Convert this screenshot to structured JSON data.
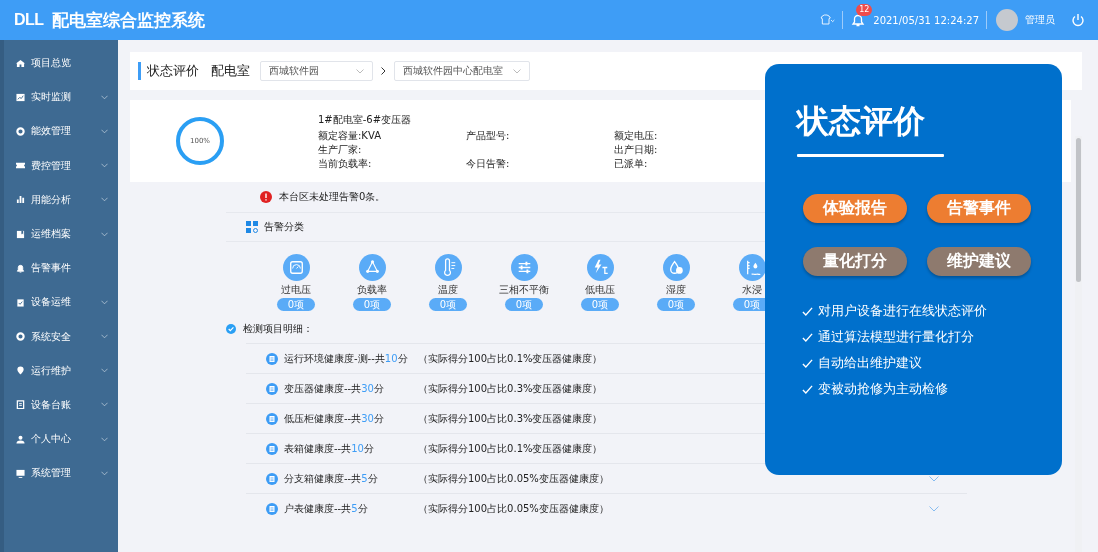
{
  "header": {
    "logo": "DLL",
    "title": "配电室综合监控系统",
    "notification_count": "12",
    "datetime": "2021/05/31 12:24:27",
    "user": "管理员"
  },
  "sidebar": {
    "items": [
      {
        "label": "项目总览",
        "kind": "home",
        "expandable": false
      },
      {
        "label": "实时监测",
        "kind": "chart",
        "expandable": true
      },
      {
        "label": "能效管理",
        "kind": "ring",
        "expandable": true
      },
      {
        "label": "费控管理",
        "kind": "ticket",
        "expandable": true
      },
      {
        "label": "用能分析",
        "kind": "bars",
        "expandable": true
      },
      {
        "label": "运维档案",
        "kind": "book",
        "expandable": true
      },
      {
        "label": "告警事件",
        "kind": "bell",
        "expandable": false
      },
      {
        "label": "设备运维",
        "kind": "clipboard",
        "expandable": true
      },
      {
        "label": "系统安全",
        "kind": "ring",
        "expandable": true
      },
      {
        "label": "运行维护",
        "kind": "pin",
        "expandable": true
      },
      {
        "label": "设备台账",
        "kind": "doc",
        "expandable": true
      },
      {
        "label": "个人中心",
        "kind": "person",
        "expandable": true
      },
      {
        "label": "系统管理",
        "kind": "monitor",
        "expandable": true
      }
    ]
  },
  "page_header": {
    "title": "状态评价",
    "label": "配电室",
    "selects": [
      {
        "value": "西城软件园"
      },
      {
        "value": "西城软件园中心配电室"
      }
    ]
  },
  "device": {
    "score": "100%",
    "level": 1,
    "name": "1#配电室-6#变压器",
    "rows": [
      [
        "额定容量:KVA",
        "产品型号:",
        "额定电压:"
      ],
      [
        "生产厂家:",
        null,
        "出产日期:"
      ],
      [
        "当前负载率:",
        "今日告警:",
        "已派单:"
      ]
    ]
  },
  "alert_notice": "本台区未处理告警0条。",
  "alert_categories": {
    "title": "告警分类",
    "items": [
      {
        "label": "过电压",
        "count": "0项",
        "kind": "gauge"
      },
      {
        "label": "负载率",
        "count": "0项",
        "kind": "triangle"
      },
      {
        "label": "温度",
        "count": "0项",
        "kind": "thermometer"
      },
      {
        "label": "三相不平衡",
        "count": "0项",
        "kind": "sliders"
      },
      {
        "label": "低电压",
        "count": "0项",
        "kind": "bolt"
      },
      {
        "label": "湿度",
        "count": "0项",
        "kind": "drops"
      },
      {
        "label": "水浸",
        "count": "0项",
        "kind": "water"
      }
    ]
  },
  "details": {
    "title": "检测项目明细：",
    "items": [
      {
        "name": "运行环境健康度-测--共",
        "score": "10",
        "unit": "分",
        "note": "（实际得分100占比0.1%变压器健康度）"
      },
      {
        "name": "变压器健康度--共",
        "score": "30",
        "unit": "分",
        "note": "（实际得分100占比0.3%变压器健康度）"
      },
      {
        "name": "低压柜健康度--共",
        "score": "30",
        "unit": "分",
        "note": "（实际得分100占比0.3%变压器健康度）"
      },
      {
        "name": "表箱健康度--共",
        "score": "10",
        "unit": "分",
        "note": "（实际得分100占比0.1%变压器健康度）"
      },
      {
        "name": "分支箱健康度--共",
        "score": "5",
        "unit": "分",
        "note": "（实际得分100占比0.05%变压器健康度）",
        "expandable": true
      },
      {
        "name": "户表健康度--共",
        "score": "5",
        "unit": "分",
        "note": "（实际得分100占比0.05%变压器健康度）",
        "expandable": true
      }
    ]
  },
  "promo": {
    "title": "状态评价",
    "buttons": [
      {
        "label": "体验报告",
        "color": "#ed7d31"
      },
      {
        "label": "告警事件",
        "color": "#ed7d31"
      },
      {
        "label": "量化打分",
        "color": "#8e7a6e"
      },
      {
        "label": "维护建议",
        "color": "#8e7a6e"
      }
    ],
    "features": [
      "对用户设备进行在线状态评价",
      "通过算法模型进行量化打分",
      "自动给出维护建议",
      "变被动抢修为主动检修"
    ]
  }
}
